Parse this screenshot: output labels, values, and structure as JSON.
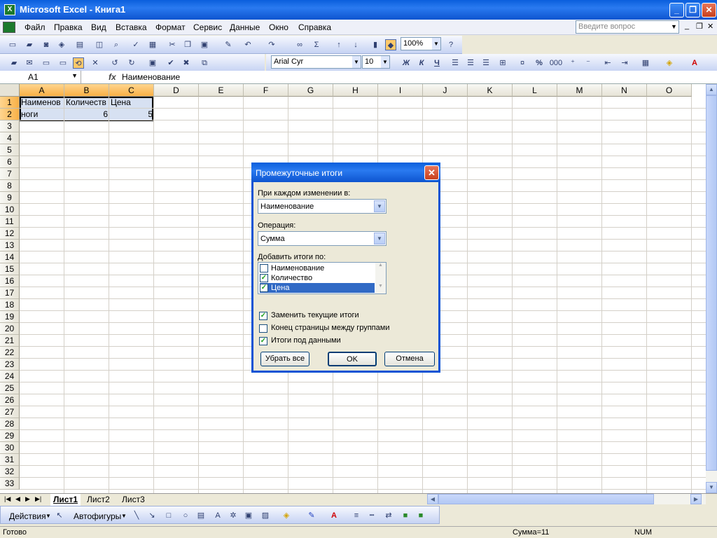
{
  "window": {
    "title": "Microsoft Excel - Книга1",
    "minimize": "_",
    "maximize": "❐",
    "close": "✕"
  },
  "menu": [
    "Файл",
    "Правка",
    "Вид",
    "Вставка",
    "Формат",
    "Сервис",
    "Данные",
    "Окно",
    "Справка"
  ],
  "question_box": {
    "placeholder": "Введите вопрос"
  },
  "mdi_buttons": [
    "_",
    "❐",
    "✕"
  ],
  "toolbar": {
    "zoom": "100%",
    "font": "Arial Cyr",
    "font_size": "10",
    "bold": "Ж",
    "italic": "К",
    "underline": "Ч",
    "percent": "%",
    "thousands": "000",
    "fx": "fx"
  },
  "formula_bar": {
    "cell_ref": "A1",
    "formula": "Наименование"
  },
  "columns": [
    "A",
    "B",
    "C",
    "D",
    "E",
    "F",
    "G",
    "H",
    "I",
    "J",
    "K",
    "L",
    "M",
    "N",
    "O"
  ],
  "rows": [
    "1",
    "2",
    "3",
    "4",
    "5",
    "6",
    "7",
    "8",
    "9",
    "10",
    "11",
    "12",
    "13",
    "14",
    "15",
    "16",
    "17",
    "18",
    "19",
    "20",
    "21",
    "22",
    "23",
    "24",
    "25",
    "26",
    "27",
    "28",
    "29",
    "30",
    "31",
    "32",
    "33"
  ],
  "cells": {
    "a1": "Наименов",
    "b1": "Количеств",
    "c1": "Цена",
    "a2": "ноги",
    "b2": "6",
    "c2": "5"
  },
  "sheets": [
    "Лист1",
    "Лист2",
    "Лист3"
  ],
  "drawing": {
    "actions": "Действия",
    "autoshapes": "Автофигуры"
  },
  "status": {
    "ready": "Готово",
    "sum": "Сумма=11",
    "num": "NUM"
  },
  "dialog": {
    "title": "Промежуточные итоги",
    "change_label": "При каждом изменении в:",
    "change_value": "Наименование",
    "operation_label": "Операция:",
    "operation_value": "Сумма",
    "add_label": "Добавить итоги по:",
    "list": [
      {
        "label": "Наименование",
        "checked": false
      },
      {
        "label": "Количество",
        "checked": true
      },
      {
        "label": "Цена",
        "checked": true
      }
    ],
    "options": [
      {
        "label": "Заменить текущие итоги",
        "checked": true
      },
      {
        "label": "Конец страницы между группами",
        "checked": false
      },
      {
        "label": "Итоги под данными",
        "checked": true
      }
    ],
    "remove_all": "Убрать все",
    "ok": "OK",
    "cancel": "Отмена"
  }
}
